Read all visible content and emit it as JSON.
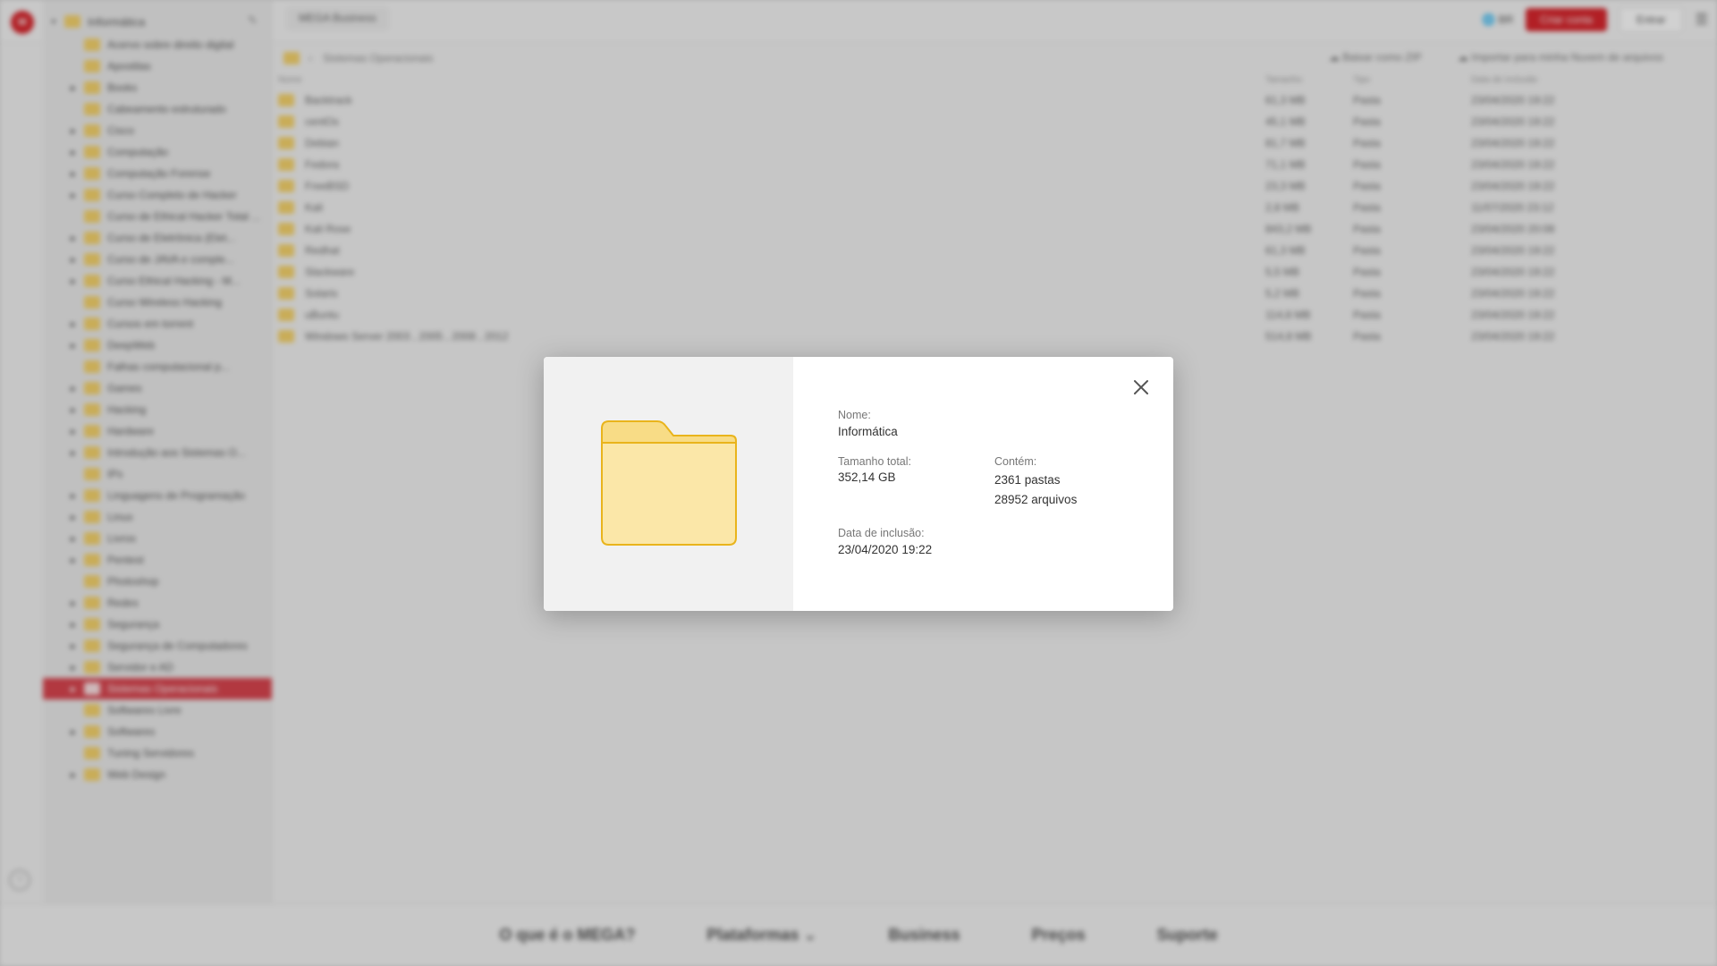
{
  "app": {
    "tab_title": "MEGA Business",
    "logo_text": "M",
    "language": "BR",
    "create_account": "Criar conta",
    "enter": "Entrar"
  },
  "sidebar": {
    "root": "Informática",
    "items": [
      {
        "label": "Acervo sobre direito digital",
        "expandable": false
      },
      {
        "label": "Apostilas",
        "expandable": false
      },
      {
        "label": "Books",
        "expandable": true
      },
      {
        "label": "Cabeamento estruturado",
        "expandable": false
      },
      {
        "label": "Cisco",
        "expandable": true
      },
      {
        "label": "Computação",
        "expandable": true
      },
      {
        "label": "Computação Forense",
        "expandable": true
      },
      {
        "label": "Curso Completo de Hacker",
        "expandable": true
      },
      {
        "label": "Curso de Ethical Hacker Total ...",
        "expandable": false
      },
      {
        "label": "Curso de Eletrônica (Elet...",
        "expandable": true
      },
      {
        "label": "Curso de JAVA e comple...",
        "expandable": true
      },
      {
        "label": "Curso Ethical Hacking - M...",
        "expandable": true
      },
      {
        "label": "Curso Wireless Hacking",
        "expandable": false
      },
      {
        "label": "Cursos em torrent",
        "expandable": true
      },
      {
        "label": "DeepWeb",
        "expandable": true
      },
      {
        "label": "Falhas computacional p...",
        "expandable": false
      },
      {
        "label": "Games",
        "expandable": true
      },
      {
        "label": "Hacking",
        "expandable": true
      },
      {
        "label": "Hardware",
        "expandable": true
      },
      {
        "label": "Introdução aos Sistemas O...",
        "expandable": true
      },
      {
        "label": "IPs",
        "expandable": false
      },
      {
        "label": "Linguagens de Programação",
        "expandable": true
      },
      {
        "label": "Linux",
        "expandable": true
      },
      {
        "label": "Livros",
        "expandable": true
      },
      {
        "label": "Pentest",
        "expandable": true
      },
      {
        "label": "Photoshop",
        "expandable": false
      },
      {
        "label": "Redes",
        "expandable": true
      },
      {
        "label": "Segurança",
        "expandable": true
      },
      {
        "label": "Segurança de Computadores",
        "expandable": true
      },
      {
        "label": "Servidor e AD",
        "expandable": true
      },
      {
        "label": "Sistemas Operacionais",
        "expandable": true,
        "selected": true
      },
      {
        "label": "Softwares Livre",
        "expandable": false
      },
      {
        "label": "Softwares",
        "expandable": true
      },
      {
        "label": "Tuning Servidores",
        "expandable": false
      },
      {
        "label": "Web Design",
        "expandable": true
      }
    ]
  },
  "breadcrumb": {
    "current": "Sistemas Operacionais",
    "download_zip": "Baixar como ZIP",
    "import_cloud": "Importar para minha Nuvem de arquivos"
  },
  "file_list": {
    "headers": {
      "name": "Nome",
      "size": "Tamanho",
      "type": "Tipo",
      "date": "Data de inclusão"
    },
    "rows": [
      {
        "name": "Backtrack",
        "size": "61,3 MB",
        "type": "Pasta",
        "date": "23/04/2020 19:22"
      },
      {
        "name": "centOs",
        "size": "45,1 MB",
        "type": "Pasta",
        "date": "23/04/2020 19:22"
      },
      {
        "name": "Debian",
        "size": "81,7 MB",
        "type": "Pasta",
        "date": "23/04/2020 19:22"
      },
      {
        "name": "Fedora",
        "size": "71,1 MB",
        "type": "Pasta",
        "date": "23/04/2020 19:22"
      },
      {
        "name": "FreeBSD",
        "size": "23,3 MB",
        "type": "Pasta",
        "date": "23/04/2020 19:22"
      },
      {
        "name": "Kali",
        "size": "2,8 MB",
        "type": "Pasta",
        "date": "11/07/2020 23:12"
      },
      {
        "name": "Kali Rose",
        "size": "843,2 MB",
        "type": "Pasta",
        "date": "23/04/2020 20:08"
      },
      {
        "name": "Redhat",
        "size": "61,3 MB",
        "type": "Pasta",
        "date": "23/04/2020 19:22"
      },
      {
        "name": "Slackware",
        "size": "5,5 MB",
        "type": "Pasta",
        "date": "23/04/2020 19:22"
      },
      {
        "name": "Solaris",
        "size": "5,2 MB",
        "type": "Pasta",
        "date": "23/04/2020 19:22"
      },
      {
        "name": "uBuntu",
        "size": "114,8 MB",
        "type": "Pasta",
        "date": "23/04/2020 19:22"
      },
      {
        "name": "Windows Server 2003 , 2005 , 2008 , 2012",
        "size": "514,8 MB",
        "type": "Pasta",
        "date": "23/04/2020 19:22"
      }
    ]
  },
  "footer": {
    "links": [
      "O que é o MEGA?",
      "Plataformas ⌄",
      "Business",
      "Preços",
      "Suporte"
    ]
  },
  "dialog": {
    "name_label": "Nome:",
    "name_value": "Informática",
    "size_label": "Tamanho total:",
    "size_value": "352,14 GB",
    "contains_label": "Contém:",
    "folders_value": "2361 pastas",
    "files_value": "28952 arquivos",
    "date_label": "Data de inclusão:",
    "date_value": "23/04/2020 19:22",
    "folder_color": "#fbe7a8",
    "folder_tab_color": "#f8dc86",
    "folder_stroke": "#e9b41c"
  }
}
